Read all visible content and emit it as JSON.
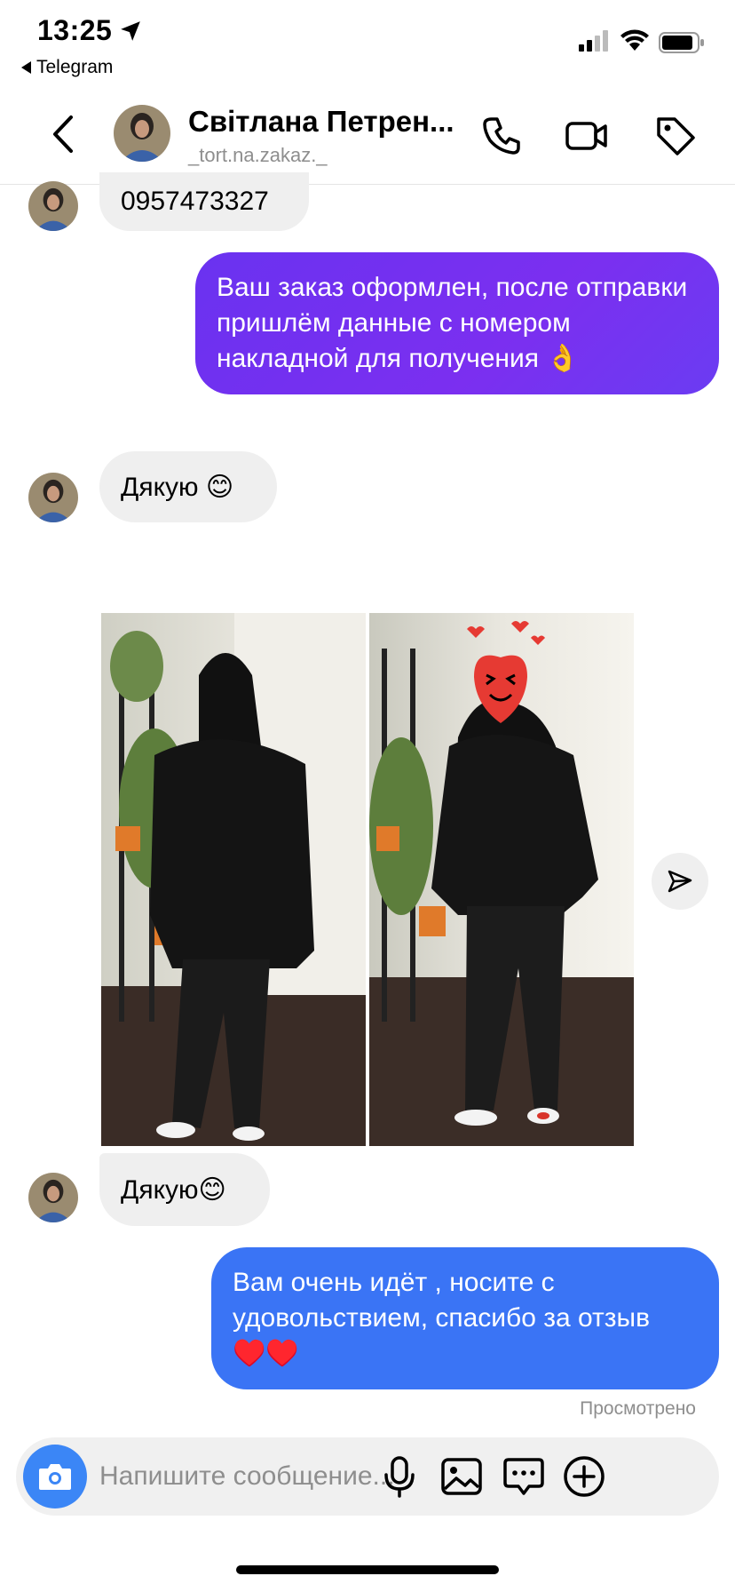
{
  "status_bar": {
    "time": "13:25",
    "back_app": "Telegram",
    "icons": [
      "location-arrow-icon",
      "signal-icon",
      "wifi-icon",
      "battery-icon"
    ]
  },
  "header": {
    "contact_name": "Світлана Петрен...",
    "username": "_tort.na.zakaz._",
    "icons": [
      "back-chevron-icon",
      "phone-icon",
      "video-icon",
      "tag-icon"
    ]
  },
  "messages": [
    {
      "direction": "in",
      "text": "0957473327"
    },
    {
      "direction": "out",
      "text": "Ваш заказ оформлен, после отправки пришлём данные с номером накладной для получения 👌"
    },
    {
      "direction": "in",
      "text": "Дякую 😊"
    },
    {
      "direction": "in",
      "type": "photo",
      "count": 2
    },
    {
      "direction": "in",
      "text": "Дякую😊"
    },
    {
      "direction": "out",
      "text": "Вам очень идёт , носите с удовольствием, спасибо за отзыв ♥️♥️"
    }
  ],
  "seen_label": "Просмотрено",
  "composer": {
    "placeholder": "Напишите сообщение...",
    "icons": [
      "camera-icon",
      "microphone-icon",
      "gallery-icon",
      "sticker-icon",
      "plus-icon"
    ]
  },
  "colors": {
    "outgoing_purple": "#6a32f0",
    "outgoing_blue": "#3a74f5",
    "incoming_bg": "#efefef",
    "camera_button": "#3b86f6"
  }
}
